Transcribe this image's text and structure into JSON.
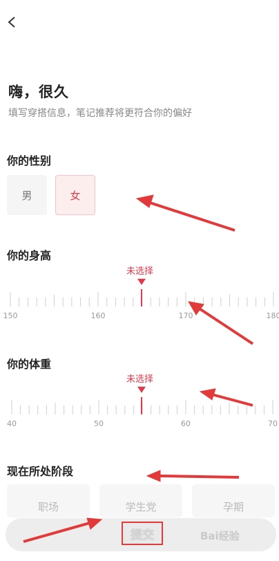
{
  "header": {
    "back_icon": "chevron-left-icon"
  },
  "intro": {
    "title": "嗨，很久",
    "subtitle": "填写穿搭信息，笔记推荐将更符合你的偏好"
  },
  "gender": {
    "title": "你的性别",
    "options": [
      "男",
      "女"
    ],
    "selected": "女"
  },
  "height": {
    "title": "你的身高",
    "marker_label": "未选择",
    "ticks": [
      "150",
      "160",
      "170",
      "180"
    ],
    "current": 165
  },
  "weight": {
    "title": "你的体重",
    "marker_label": "未选择",
    "ticks": [
      "40",
      "50",
      "60",
      "70"
    ],
    "current": 55
  },
  "stage": {
    "title": "现在所处阶段",
    "options": [
      "职场",
      "学生党",
      "孕期"
    ]
  },
  "submit": {
    "label": "提交"
  },
  "watermark": {
    "text": "Bai经验"
  },
  "colors": {
    "accent": "#e4394b",
    "annotation": "#e23a3a"
  }
}
